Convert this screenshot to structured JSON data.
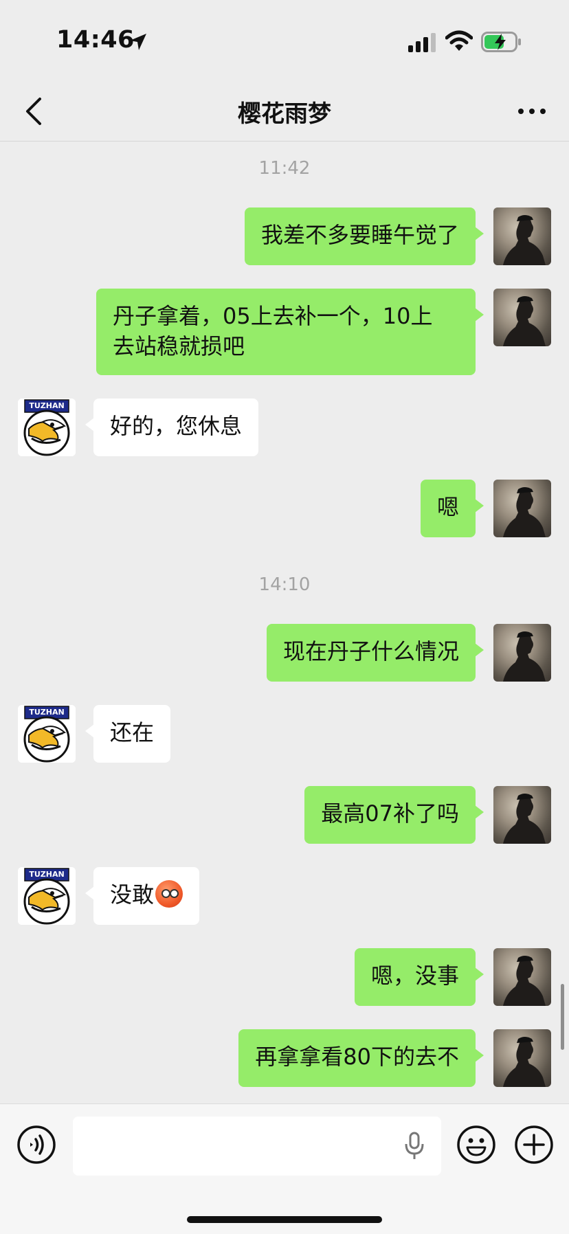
{
  "status_bar": {
    "time": "14:46",
    "battery": "charging"
  },
  "nav": {
    "title": "樱花雨梦"
  },
  "timestamps": [
    "11:42",
    "14:10"
  ],
  "other_avatar": {
    "label": "TUZHAN"
  },
  "messages": [
    {
      "from": "me",
      "text": "我差不多要睡午觉了"
    },
    {
      "from": "me",
      "line1": "丹子拿着，05上去补一个，10上",
      "line2": "去站稳就损吧"
    },
    {
      "from": "other",
      "text": "好的，您休息"
    },
    {
      "from": "me",
      "text": "嗯"
    },
    {
      "from": "me",
      "text": "现在丹子什么情况"
    },
    {
      "from": "other",
      "text": "还在"
    },
    {
      "from": "me",
      "text": "最高07补了吗"
    },
    {
      "from": "other",
      "text": "没敢",
      "emoji": "cold-sweat-face"
    },
    {
      "from": "me",
      "text": "嗯，没事"
    },
    {
      "from": "me",
      "text": "再拿拿看80下的去不"
    }
  ],
  "input": {
    "placeholder": ""
  },
  "colors": {
    "bubble_me": "#95ec69",
    "bubble_other": "#ffffff",
    "background": "#ededed"
  }
}
